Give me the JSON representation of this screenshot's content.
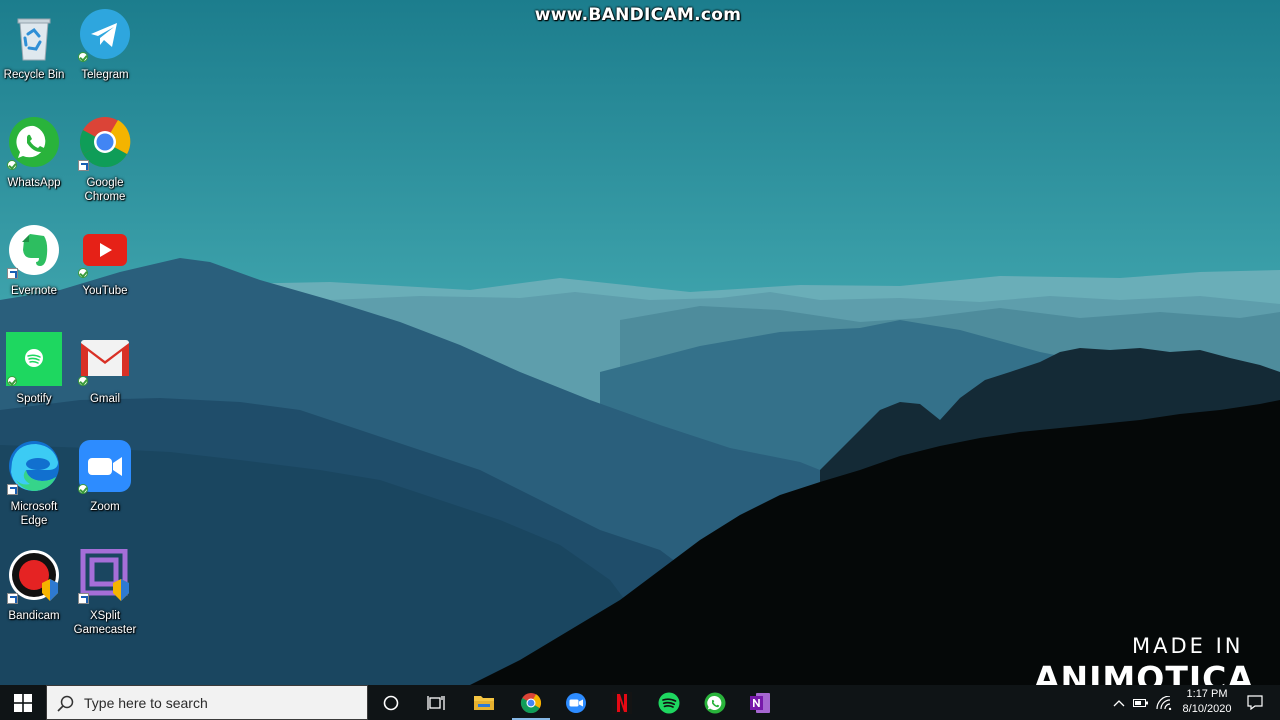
{
  "watermarks": {
    "top": "www.BANDICAM.com",
    "made_in": "MADE IN",
    "brand": "ANIMOTICA"
  },
  "desktop": {
    "icons": [
      {
        "id": "recycle-bin",
        "label": "Recycle Bin",
        "icon": "recycle-bin-icon",
        "badge": "none"
      },
      {
        "id": "telegram",
        "label": "Telegram",
        "icon": "telegram-icon",
        "badge": "sync-check"
      },
      {
        "id": "whatsapp",
        "label": "WhatsApp",
        "icon": "whatsapp-icon",
        "badge": "sync-check"
      },
      {
        "id": "google-chrome",
        "label": "Google Chrome",
        "icon": "chrome-icon",
        "badge": "shortcut"
      },
      {
        "id": "evernote",
        "label": "Evernote",
        "icon": "evernote-icon",
        "badge": "shortcut"
      },
      {
        "id": "youtube",
        "label": "YouTube",
        "icon": "youtube-icon",
        "badge": "sync-check"
      },
      {
        "id": "spotify",
        "label": "Spotify",
        "icon": "spotify-icon",
        "badge": "sync-check"
      },
      {
        "id": "gmail",
        "label": "Gmail",
        "icon": "gmail-icon",
        "badge": "sync-check"
      },
      {
        "id": "microsoft-edge",
        "label": "Microsoft Edge",
        "icon": "edge-icon",
        "badge": "shortcut"
      },
      {
        "id": "zoom",
        "label": "Zoom",
        "icon": "zoom-icon",
        "badge": "sync-check"
      },
      {
        "id": "bandicam",
        "label": "Bandicam",
        "icon": "bandicam-icon",
        "badge": "shortcut"
      },
      {
        "id": "xsplit-gamecaster",
        "label": "XSplit Gamecaster",
        "icon": "xsplit-icon",
        "badge": "shortcut"
      }
    ]
  },
  "taskbar": {
    "start_icon": "windows-logo-icon",
    "search_placeholder": "Type here to search",
    "pinned": [
      {
        "id": "cortana",
        "icon": "cortana-circle-icon",
        "active": false
      },
      {
        "id": "task-view",
        "icon": "task-view-icon",
        "active": false
      },
      {
        "id": "file-explorer",
        "icon": "folder-icon",
        "active": false
      },
      {
        "id": "chrome",
        "icon": "chrome-icon",
        "active": true
      },
      {
        "id": "zoom",
        "icon": "zoom-icon",
        "active": false
      },
      {
        "id": "netflix",
        "icon": "netflix-icon",
        "active": false
      },
      {
        "id": "spotify",
        "icon": "spotify-icon",
        "active": false
      },
      {
        "id": "whatsapp",
        "icon": "whatsapp-icon",
        "active": false
      },
      {
        "id": "onenote",
        "icon": "onenote-icon",
        "active": false
      }
    ],
    "tray": {
      "show_hidden_icon": "chevron-up-icon",
      "battery_icon": "battery-icon",
      "network_icon": "wifi-icon",
      "time": "1:17 PM",
      "date": "8/10/2020",
      "notifications_icon": "action-center-icon"
    }
  },
  "colors": {
    "sky_top": "#1e7f8f",
    "sky_bottom": "#7ec7cc",
    "taskbar": "#0f1416",
    "search_box": "#f2f2f2"
  }
}
